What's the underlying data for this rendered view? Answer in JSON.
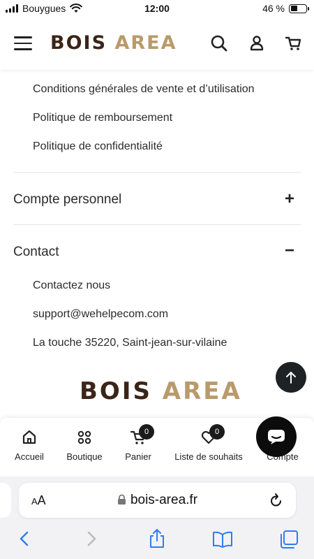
{
  "status_bar": {
    "carrier": "Bouygues",
    "time": "12:00",
    "battery": "46 %",
    "battery_level": 0.46
  },
  "header": {
    "logo_main": "BOIS ",
    "logo_accent": "AREA",
    "icons": [
      "menu-icon",
      "search-icon",
      "user-icon",
      "cart-icon"
    ]
  },
  "legal_links": [
    "Conditions générales de vente et d’utilisation",
    "Politique de remboursement",
    "Politique de confidentialité"
  ],
  "sections": {
    "account": {
      "title": "Compte personnel",
      "toggle": "+"
    },
    "contact": {
      "title": "Contact",
      "toggle": "−",
      "items": [
        "Contactez nous",
        "support@wehelpecom.com",
        "La touche 35220, Saint-jean-sur-vilaine"
      ]
    }
  },
  "footer_logo": {
    "main": "BOIS ",
    "accent": "AREA"
  },
  "bottom_nav": {
    "items": [
      "Accueil",
      "Boutique",
      "Panier",
      "Liste de souhaits",
      "Compte"
    ],
    "cart_count": "0",
    "wishlist_count": "0"
  },
  "browser": {
    "text_size_label": "AA",
    "url": "bois-area.fr"
  },
  "colors": {
    "brand_brown": "#3b2418",
    "brand_gold": "#b99a6a",
    "ios_blue": "#2f7bf6"
  }
}
